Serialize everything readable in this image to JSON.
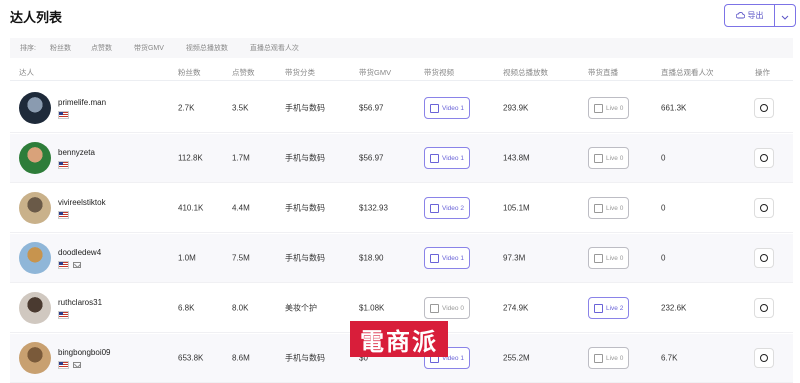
{
  "page_title": "达人列表",
  "export": {
    "label": "导出"
  },
  "sort": {
    "label": "排序:",
    "options": [
      "粉丝数",
      "点赞数",
      "带货GMV",
      "视频总播放数",
      "直播总观看人次"
    ]
  },
  "columns": [
    "达人",
    "粉丝数",
    "点赞数",
    "带货分类",
    "带货GMV",
    "带货视频",
    "视频总播放数",
    "带货直播",
    "直播总观看人次",
    "操作"
  ],
  "rows": [
    {
      "name": "primelife.man",
      "followers": "2.7K",
      "likes": "3.5K",
      "category": "手机与数码",
      "gmv": "$56.97",
      "video": "Video 1",
      "views": "293.9K",
      "live": "Live 0",
      "live_viewers": "661.3K",
      "mail": false
    },
    {
      "name": "bennyzeta",
      "followers": "112.8K",
      "likes": "1.7M",
      "category": "手机与数码",
      "gmv": "$56.97",
      "video": "Video 1",
      "views": "143.8M",
      "live": "Live 0",
      "live_viewers": "0",
      "mail": false
    },
    {
      "name": "vivireelstiktok",
      "followers": "410.1K",
      "likes": "4.4M",
      "category": "手机与数码",
      "gmv": "$132.93",
      "video": "Video 2",
      "views": "105.1M",
      "live": "Live 0",
      "live_viewers": "0",
      "mail": false
    },
    {
      "name": "doodledew4",
      "followers": "1.0M",
      "likes": "7.5M",
      "category": "手机与数码",
      "gmv": "$18.90",
      "video": "Video 1",
      "views": "97.3M",
      "live": "Live 0",
      "live_viewers": "0",
      "mail": true
    },
    {
      "name": "ruthclaros31",
      "followers": "6.8K",
      "likes": "8.0K",
      "category": "美妆个护",
      "gmv": "$1.08K",
      "video": "Video 0",
      "views": "274.9K",
      "live": "Live 2",
      "live_viewers": "232.6K",
      "mail": false
    },
    {
      "name": "bingbongboi09",
      "followers": "653.8K",
      "likes": "8.6M",
      "category": "手机与数码",
      "gmv": "$0",
      "video": "Video 1",
      "views": "255.2M",
      "live": "Live 0",
      "live_viewers": "6.7K",
      "mail": true
    }
  ],
  "watermark": "電商派"
}
